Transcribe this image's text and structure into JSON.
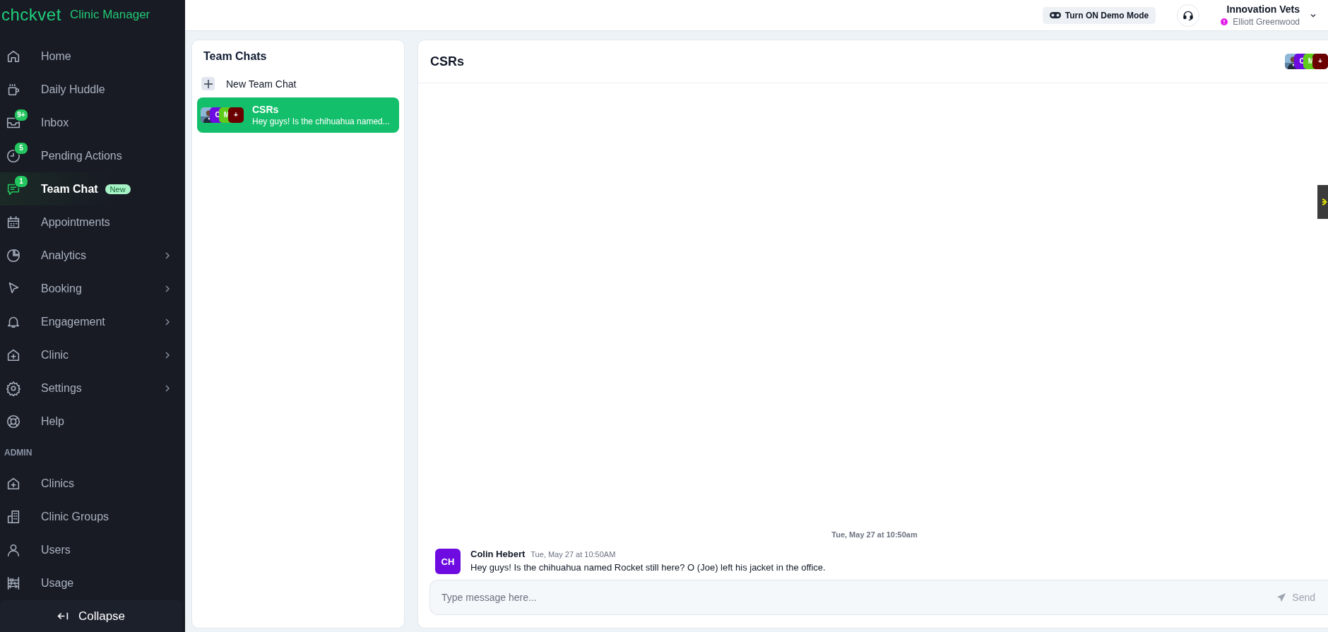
{
  "brand": {
    "logo": "chckvet",
    "subtitle": "Clinic Manager"
  },
  "nav": [
    {
      "label": "Home",
      "expandable": false,
      "selected": false
    },
    {
      "label": "Daily Huddle",
      "expandable": false,
      "selected": false
    },
    {
      "label": "Inbox",
      "badge": "9+",
      "expandable": false,
      "selected": false
    },
    {
      "label": "Pending Actions",
      "badge": "5",
      "expandable": false,
      "selected": false
    },
    {
      "label": "Team Chat",
      "badge": "1",
      "tag": "New",
      "expandable": false,
      "selected": true
    },
    {
      "label": "Appointments",
      "expandable": false,
      "selected": false
    },
    {
      "label": "Analytics",
      "expandable": true,
      "selected": false
    },
    {
      "label": "Booking",
      "expandable": true,
      "selected": false
    },
    {
      "label": "Engagement",
      "expandable": true,
      "selected": false
    },
    {
      "label": "Clinic",
      "expandable": true,
      "selected": false
    },
    {
      "label": "Settings",
      "expandable": true,
      "selected": false
    },
    {
      "label": "Help",
      "expandable": false,
      "selected": false
    }
  ],
  "admin": {
    "title": "ADMIN",
    "items": [
      {
        "label": "Clinics",
        "expandable": false,
        "selected": false
      },
      {
        "label": "Clinic Groups",
        "expandable": false,
        "selected": false
      },
      {
        "label": "Users",
        "expandable": false,
        "selected": false
      },
      {
        "label": "Usage",
        "expandable": false,
        "selected": false
      }
    ]
  },
  "collapse": "Collapse",
  "header": {
    "demo_button": "Turn ON Demo Mode",
    "org": "Innovation Vets",
    "user": "Elliott Greenwood"
  },
  "chat_list": {
    "title": "Team Chats",
    "new_chat": "New Team Chat",
    "chats": [
      {
        "name": "CSRs",
        "preview": "Hey guys! Is the chihuahua named...",
        "selected": true,
        "avatars": [
          {
            "kind": "picture"
          },
          {
            "kind": "initial",
            "text": "C",
            "color": "#6d0be0"
          },
          {
            "kind": "initial",
            "text": "M",
            "color": "#5fcc1c"
          },
          {
            "kind": "initial",
            "text": "+",
            "color": "#6b0000"
          }
        ]
      }
    ]
  },
  "conversation": {
    "title": "CSRs",
    "avatars": [
      {
        "kind": "picture"
      },
      {
        "kind": "initial",
        "text": "C",
        "color": "#6d0be0"
      },
      {
        "kind": "initial",
        "text": "M",
        "color": "#5fcc1c"
      },
      {
        "kind": "initial",
        "text": "+",
        "color": "#6b0000"
      }
    ],
    "date_divider": "Tue, May 27 at 10:50am",
    "messages": [
      {
        "initials": "CH",
        "color": "#6d0be0",
        "author": "Colin Hebert",
        "time": "Tue, May 27 at 10:50AM",
        "text": "Hey guys! Is the chihuahua named Rocket still here? O (Joe) left his jacket in the office."
      }
    ],
    "composer": {
      "placeholder": "Type message here...",
      "send": "Send"
    }
  }
}
